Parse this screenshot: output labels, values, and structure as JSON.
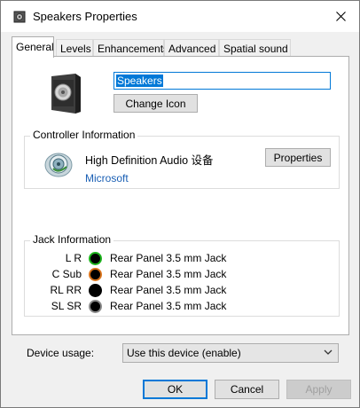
{
  "window": {
    "title": "Speakers Properties"
  },
  "tabs": [
    {
      "label": "General",
      "active": true
    },
    {
      "label": "Levels"
    },
    {
      "label": "Enhancements"
    },
    {
      "label": "Advanced"
    },
    {
      "label": "Spatial sound"
    }
  ],
  "general": {
    "device_name": "Speakers",
    "change_icon_label": "Change Icon"
  },
  "controller": {
    "group_label": "Controller Information",
    "name": "High Definition Audio 设备",
    "vendor": "Microsoft",
    "properties_label": "Properties"
  },
  "jacks": {
    "group_label": "Jack Information",
    "items": [
      {
        "channel": "L R",
        "description": "Rear Panel 3.5 mm Jack",
        "color": "#1db31d"
      },
      {
        "channel": "C Sub",
        "description": "Rear Panel 3.5 mm Jack",
        "color": "#d9741c"
      },
      {
        "channel": "RL RR",
        "description": "Rear Panel 3.5 mm Jack",
        "color": "#000000"
      },
      {
        "channel": "SL SR",
        "description": "Rear Panel 3.5 mm Jack",
        "color": "#8a8a8a"
      }
    ]
  },
  "device_usage": {
    "label": "Device usage:",
    "selected": "Use this device (enable)"
  },
  "footer": {
    "ok_label": "OK",
    "cancel_label": "Cancel",
    "apply_label": "Apply"
  },
  "colors": {
    "accent": "#0078d7",
    "link": "#1a5fb4"
  }
}
